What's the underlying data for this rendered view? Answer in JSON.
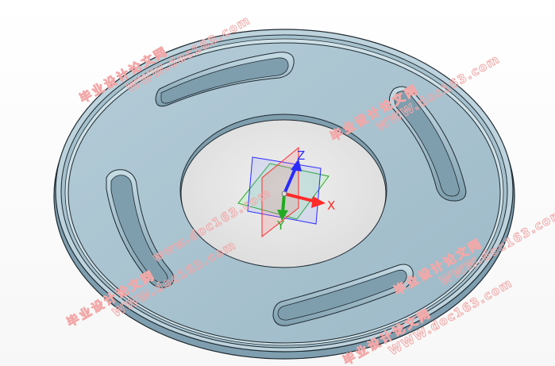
{
  "viewport": {
    "background_color": "#ffffff",
    "part": {
      "face_color": "#a8c3d1",
      "edge_color": "#1f2a30",
      "slot_count": 4,
      "has_center_hole": true
    },
    "triad": {
      "x_label": "X",
      "y_label": "Y",
      "z_label": "Z",
      "x_color": "#ff2a2a",
      "y_color": "#22aa22",
      "z_color": "#2a2aff"
    },
    "watermarks": [
      {
        "cn": "毕业设计论文网",
        "url": "WWW.doc163.com"
      },
      {
        "cn": "毕业设计论文网",
        "url": "WWW.doc163.com"
      },
      {
        "cn": "毕业设计论文网",
        "url": "WWW.doc163.com"
      },
      {
        "cn": "",
        "url": "www.doc163.com"
      },
      {
        "cn": "毕业设计论文网",
        "url": "WWW.doc163.com"
      },
      {
        "cn": "毕业设计论文网",
        "url": "WWW.doc163.com"
      }
    ]
  }
}
